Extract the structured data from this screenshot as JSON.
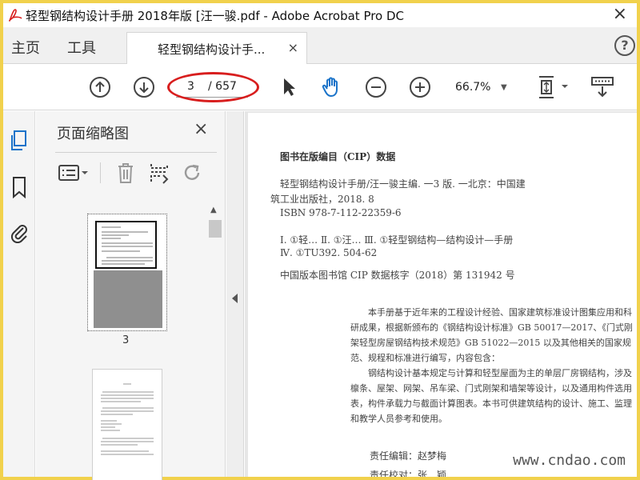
{
  "window": {
    "title": "轻型钢结构设计手册 2018年版 [汪一骏.pdf - Adobe Acrobat Pro DC",
    "close_glyph": "×"
  },
  "nav": {
    "home": "主页",
    "tools": "工具"
  },
  "tab": {
    "label": "轻型钢结构设计手...",
    "close_glyph": "×"
  },
  "help": {
    "glyph": "?"
  },
  "toolbar": {
    "current_page": "3",
    "total_pages": "/ 657",
    "zoom": "66.7%",
    "zoom_caret": "▼"
  },
  "thumbnails": {
    "title": "页面缩略图",
    "close_glyph": "×",
    "page_label": "3"
  },
  "document": {
    "cip_heading": "图书在版编目（CIP）数据",
    "cip_line1": "轻型钢结构设计手册/汪一骏主编. 一3 版. 一北京：中国建",
    "cip_line2": "筑工业出版社，2018. 8",
    "isbn": "ISBN 978-7-112-22359-6",
    "class_line1": "Ⅰ. ①轻…   Ⅱ. ①汪…   Ⅲ. ①轻型钢结构—结构设计—手册",
    "class_line2": "Ⅳ. ①TU392. 504-62",
    "cip_record": "中国版本图书馆 CIP 数据核字（2018）第 131942 号",
    "para1": "本手册基于近年来的工程设计经验、国家建筑标准设计图集应用和科研成果，根据新颁布的《钢结构设计标准》GB 50017—2017、《门式刚架轻型房屋钢结构技术规范》GB 51022—2015 以及其他相关的国家规范、规程和标准进行编写，内容包含：",
    "para2": "钢结构设计基本规定与计算和轻型屋面为主的单层厂房钢结构，涉及檩条、屋架、网架、吊车梁、门式刚架和墙架等设计，以及通用构件选用表，构件承载力与截面计算图表。本书可供建筑结构的设计、施工、监理和教学人员参考和使用。",
    "editor": "责任编辑：赵梦梅",
    "proofreader": "责任校对：张　颖",
    "watermark": "www.cndao.com"
  }
}
